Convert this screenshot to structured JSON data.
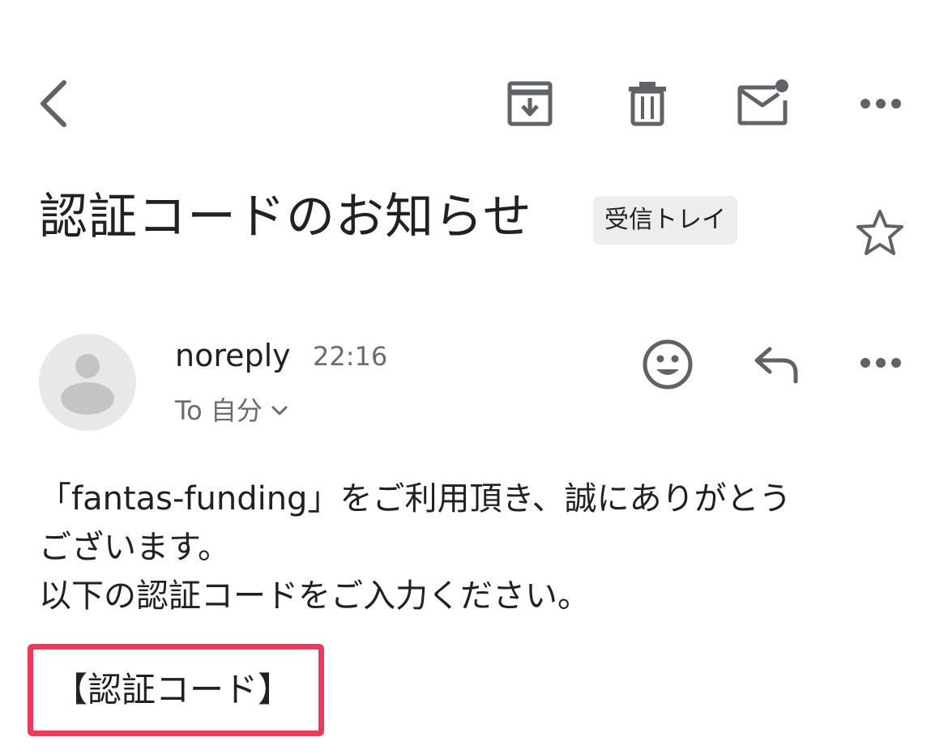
{
  "toolbar": {
    "back_icon": "chevron-left-icon",
    "archive_icon": "archive-icon",
    "delete_icon": "trash-icon",
    "mark_unread_icon": "mail-unread-icon",
    "more_icon": "more-horizontal-icon"
  },
  "email": {
    "subject": "認証コードのお知らせ",
    "label": "受信トレイ",
    "sender_name": "noreply",
    "time": "22:16",
    "recipient": "To 自分",
    "body_lines": [
      "「fantas-funding」をご利用頂き、誠にありがとう",
      "ございます。",
      "以下の認証コードをご入力ください。"
    ],
    "code_label": "【認証コード】"
  },
  "colors": {
    "icon": "#5f6368",
    "highlight": "#f2385a",
    "chip_bg": "#ededed",
    "avatar_bg": "#e8e8e8"
  }
}
